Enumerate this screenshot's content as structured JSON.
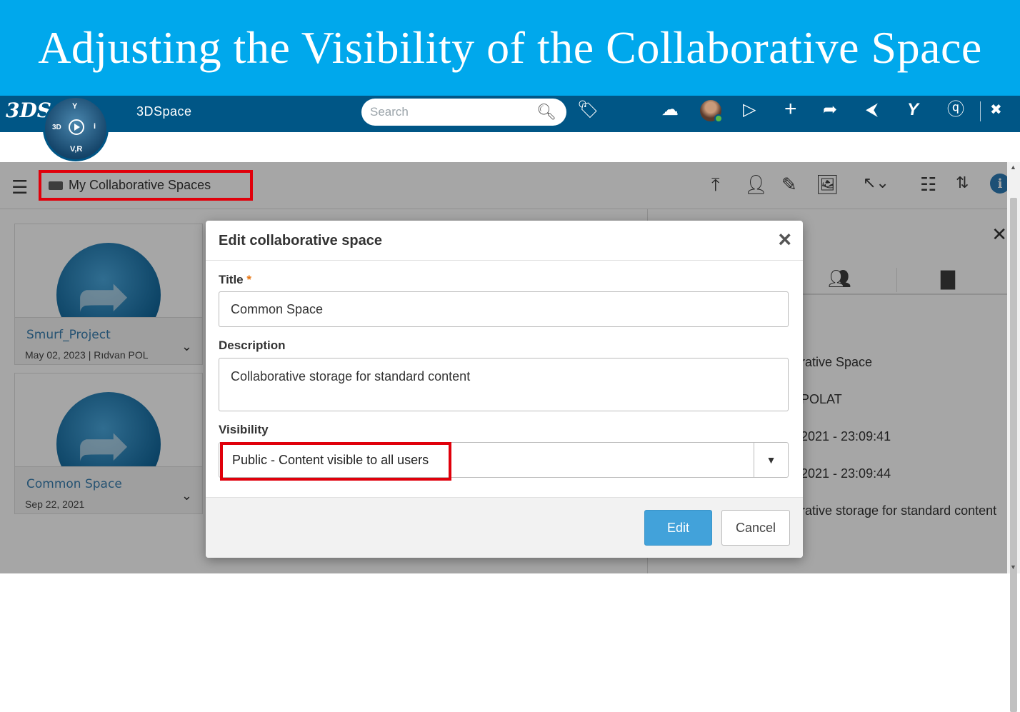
{
  "slide": {
    "title": "Adjusting the Visibility of the Collaborative Space"
  },
  "topbar": {
    "brand": "3DS",
    "compass": {
      "top": "Y",
      "left": "3D",
      "right": "i",
      "bottom": "V,R"
    },
    "app_name": "3DSpace",
    "search_placeholder": "Search",
    "icons": [
      "search-icon",
      "tag-icon",
      "cloud-icon",
      "avatar",
      "chat-icon",
      "plus-icon",
      "share-icon",
      "social-share-icon",
      "community-icon",
      "help-icon",
      "fullscreen-icon"
    ]
  },
  "toolbar": {
    "breadcrumb": "My Collaborative Spaces",
    "icons": [
      "upload-icon",
      "add-member-icon",
      "edit-pencil-icon",
      "image-icon",
      "select-icon",
      "grid-view-icon",
      "sort-icon",
      "info-icon"
    ]
  },
  "tiles": [
    {
      "name": "Smurf_Project",
      "date": "May 02, 2023 | Rıdvan POL"
    },
    {
      "name": "Common Space",
      "date": "Sep 22, 2021"
    }
  ],
  "side_panel": {
    "rows": [
      "rative Space",
      "POLAT",
      "2021 - 23:09:41",
      "2021 - 23:09:44",
      "rative storage for standard content"
    ]
  },
  "modal": {
    "title": "Edit collaborative space",
    "title_label": "Title",
    "required_mark": "*",
    "title_value": "Common Space",
    "description_label": "Description",
    "description_value": "Collaborative storage for standard content",
    "visibility_label": "Visibility",
    "visibility_value": "Public - Content visible to all users",
    "edit_button": "Edit",
    "cancel_button": "Cancel"
  },
  "colors": {
    "banner": "#00a8ec",
    "topbar": "#005686",
    "highlight": "#e0000b",
    "primary_button": "#42a2da"
  }
}
